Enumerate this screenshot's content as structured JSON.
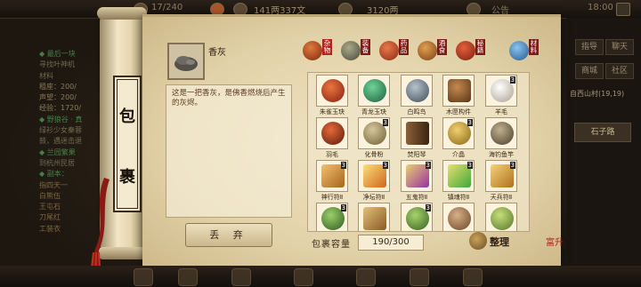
{
  "status_bar": {
    "exp": "17/240",
    "money": "141两337文",
    "weight": "3120两",
    "notice": "公告",
    "time": "18:00"
  },
  "background_quests": {
    "lines": [
      "◆ 最后一块",
      "寻找叶神机",
      "材料",
      "租座：200/",
      "声望：200/",
      "经验：1720/",
      "◆ 野狼谷 · 真",
      "绿衫少女秦蓉",
      "鼓，遇迷击退",
      "◆ 兰园繁果",
      "到杭州民居",
      "◆ 副本：",
      "指四天一",
      "白熊伍",
      "王屯石",
      "刀尾红",
      "工装衣"
    ]
  },
  "background_right": {
    "buttons": [
      "指导",
      "聊天",
      "商城",
      "社区"
    ],
    "location": "自西山村(19,19)",
    "button_big": "石子路"
  },
  "scroll_label": [
    "包",
    "裹"
  ],
  "selected_item": {
    "name": "香灰",
    "description": "这是一把香灰，是佛香燃烧后产生的灰烬。",
    "icon": "incense-ash-icon"
  },
  "drop_button": "丢 弃",
  "tabs": [
    {
      "label": "杂物",
      "icon": "misc-icon",
      "color": "#b4441c",
      "selected": true
    },
    {
      "label": "装备",
      "icon": "equipment-icon",
      "color": "#6a6a52",
      "selected": false
    },
    {
      "label": "药品",
      "icon": "medicine-icon",
      "color": "#c24a2c",
      "selected": false
    },
    {
      "label": "酒食",
      "icon": "food-icon",
      "color": "#b56a2a",
      "selected": false
    },
    {
      "label": "秘籍",
      "icon": "manual-icon",
      "color": "#c9462b",
      "selected": false
    },
    {
      "label": "材料",
      "icon": "material-icon",
      "color": "#3f78b8",
      "selected": false
    }
  ],
  "items": [
    {
      "name": "朱雀玉玦",
      "icon": "vermilion-bird-jade-icon",
      "count": "",
      "color": "#c23a1f"
    },
    {
      "name": "青龙玉玦",
      "icon": "azure-dragon-jade-icon",
      "count": "",
      "color": "#2e8a5a"
    },
    {
      "name": "白鸣鸟",
      "icon": "white-bird-icon",
      "count": "",
      "color": "#6f7a86"
    },
    {
      "name": "木匣构件",
      "icon": "wooden-box-part-icon",
      "count": "",
      "color": "#8a5a2e"
    },
    {
      "name": "羊毛",
      "icon": "wool-icon",
      "count": "3",
      "color": "#d9d2c0"
    },
    {
      "name": "羽毛",
      "icon": "feather-icon",
      "count": "",
      "color": "#b23a1e"
    },
    {
      "name": "化骨粉",
      "icon": "bone-powder-icon",
      "count": "3",
      "color": "#9b8a55"
    },
    {
      "name": "焚阳琴",
      "icon": "zither-icon",
      "count": "",
      "color": "#6b4a2a"
    },
    {
      "name": "介晶",
      "icon": "crystal-icon",
      "count": "3",
      "color": "#c9a23a"
    },
    {
      "name": "海钓鱼竿",
      "icon": "fishing-rod-icon",
      "count": "",
      "color": "#7a6a4a"
    },
    {
      "name": "神行符Ⅱ",
      "icon": "swift-talisman-icon",
      "count": "3",
      "color": "#d99a3a"
    },
    {
      "name": "净坛符Ⅱ",
      "icon": "purify-talisman-icon",
      "count": "3",
      "color": "#e2b23e"
    },
    {
      "name": "五鬼符Ⅱ",
      "icon": "five-ghost-talisman-icon",
      "count": "3",
      "color": "#c89f3a"
    },
    {
      "name": "镇魂符Ⅱ",
      "icon": "soul-talisman-icon",
      "count": "3",
      "color": "#b9c048"
    },
    {
      "name": "天兵符Ⅱ",
      "icon": "heaven-talisman-icon",
      "count": "3",
      "color": "#d9a040"
    },
    {
      "name": "",
      "icon": "herb-icon",
      "count": "3",
      "color": "#5a8a3a"
    },
    {
      "name": "",
      "icon": "scroll-icon",
      "count": "",
      "color": "#c09550"
    },
    {
      "name": "",
      "icon": "plant-icon",
      "count": "3",
      "color": "#6b8f3c"
    },
    {
      "name": "",
      "icon": "mushroom-icon",
      "count": "",
      "color": "#a8805a"
    },
    {
      "name": "",
      "icon": "leaf-icon",
      "count": "",
      "color": "#8aa54a"
    }
  ],
  "capacity": {
    "label": "包裹容量",
    "value": "190/300"
  },
  "sort_button": "整理",
  "seal_text": "富升"
}
